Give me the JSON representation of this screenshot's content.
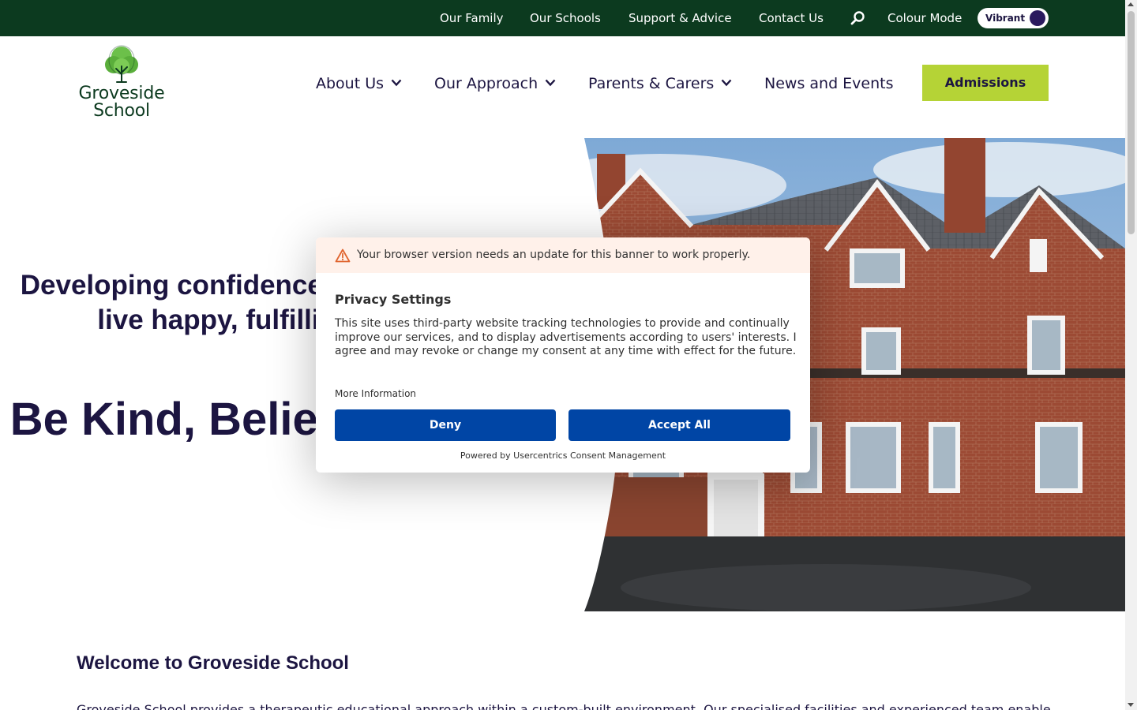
{
  "topbar": {
    "links": [
      "Our Family",
      "Our Schools",
      "Support & Advice",
      "Contact Us"
    ],
    "colour_mode_label": "Colour Mode",
    "colour_mode_value": "Vibrant",
    "search_icon": "search-icon"
  },
  "logo": {
    "name": "Groveside\nSchool",
    "icon": "tree-icon"
  },
  "nav": {
    "about": "About Us",
    "approach": "Our Approach",
    "parents": "Parents & Carers",
    "news": "News and Events",
    "admissions": "Admissions"
  },
  "hero": {
    "tagline": "Developing confidence and values to live happy, fulfilling lives.",
    "motto": "Be Kind, Believe in You"
  },
  "welcome": {
    "title": "Welcome to Groveside School",
    "intro": "Groveside School provides a therapeutic educational approach within a custom-built environment. Our specialised facilities and experienced team enable"
  },
  "consent": {
    "warning": "Your browser version needs an update for this banner to work properly.",
    "title": "Privacy Settings",
    "body": "This site uses third-party website tracking technologies to provide and continually improve our services, and to display advertisements according to users' interests. I agree and may revoke or change my consent at any time with effect for the future.",
    "more": "More Information",
    "deny": "Deny",
    "accept": "Accept All",
    "powered": "Powered by Usercentrics Consent Management"
  },
  "colors": {
    "topbar_bg": "#0c3a1f",
    "text_navy": "#1c1541",
    "admissions_bg": "#b5d336",
    "consent_button": "#0045a5",
    "warning_bg": "#fff1ea"
  }
}
